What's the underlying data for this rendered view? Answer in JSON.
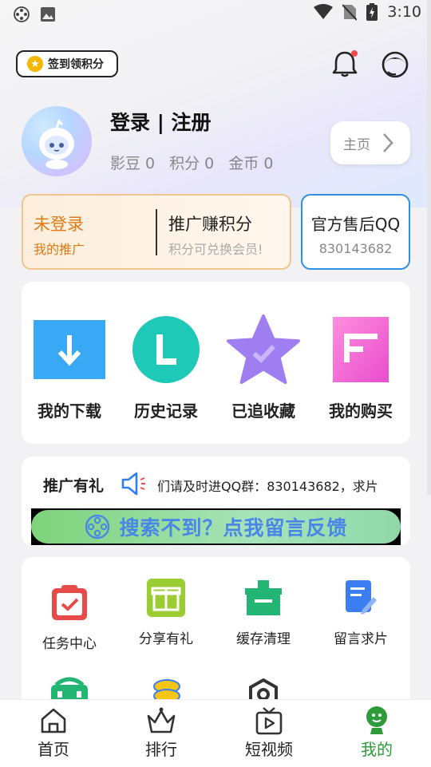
{
  "status_bar": {
    "time": "3:10"
  },
  "header": {
    "checkin_label": "签到领积分",
    "coin_glyph": "★"
  },
  "profile": {
    "login_label": "登录 | 注册",
    "stats": [
      "影豆 0",
      "积分 0",
      "金币 0"
    ],
    "home_button": "主页"
  },
  "promo": {
    "left_title": "未登录",
    "left_sub": "我的推广",
    "right_title": "推广赚积分",
    "right_sub": "积分可兑换会员!"
  },
  "qq_card": {
    "title": "官方售后QQ",
    "number": "830143682"
  },
  "quick_actions": [
    {
      "label": "我的下载",
      "icon": "download-icon",
      "color": "#3aa9f5"
    },
    {
      "label": "历史记录",
      "icon": "history-icon",
      "color": "#1fc9b7"
    },
    {
      "label": "已追收藏",
      "icon": "star-icon",
      "color": "#9f7ef2"
    },
    {
      "label": "我的购买",
      "icon": "purchase-icon",
      "color": "#f25fcf"
    }
  ],
  "notice": {
    "title": "推广有礼",
    "marquee": "们请及时进QQ群：830143682，求片"
  },
  "feedback_banner": {
    "text": "搜索不到？点我留言反馈"
  },
  "tools": [
    {
      "label": "任务中心",
      "icon": "task-center-icon"
    },
    {
      "label": "分享有礼",
      "icon": "gift-icon"
    },
    {
      "label": "缓存清理",
      "icon": "cache-clean-icon"
    },
    {
      "label": "留言求片",
      "icon": "message-request-icon"
    }
  ],
  "bottom_nav": [
    {
      "label": "首页",
      "icon": "home-icon",
      "active": false
    },
    {
      "label": "排行",
      "icon": "ranking-icon",
      "active": false
    },
    {
      "label": "短视频",
      "icon": "short-video-icon",
      "active": false
    },
    {
      "label": "我的",
      "icon": "profile-icon",
      "active": true
    }
  ],
  "colors": {
    "accent": "#2e9b3b",
    "promo_orange": "#e07a12",
    "qq_blue": "#2e8ee8"
  }
}
